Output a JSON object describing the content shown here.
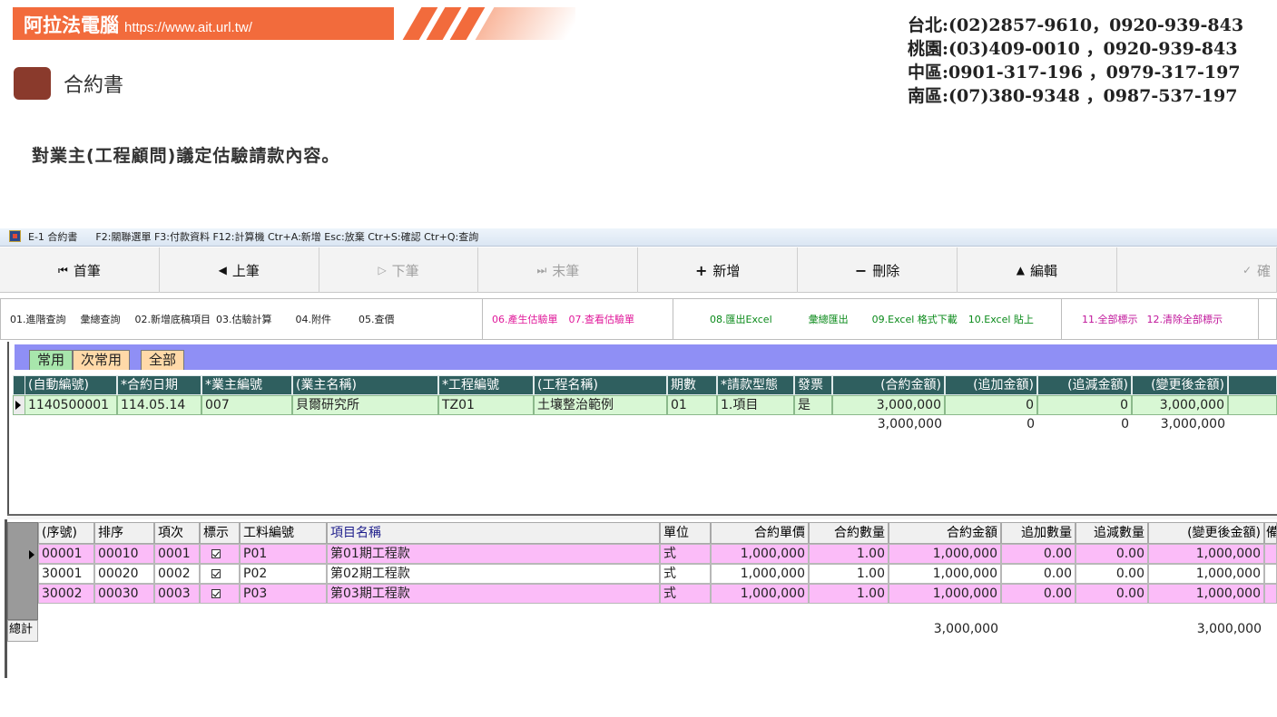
{
  "header": {
    "brand": "阿拉法電腦",
    "url": "https://www.ait.url.tw/",
    "page_title": "合約書",
    "contacts": [
      "台北:(02)2857-9610，0920-939-843",
      "桃園:(03)409-0010 ，0920-939-843",
      "中區:0901-317-196 ，0979-317-197",
      "南區:(07)380-9348 ，0987-537-197"
    ],
    "description": "對業主(工程顧問)議定估驗請款內容。"
  },
  "window": {
    "title": "E-1 合約書",
    "hotkeys": "F2:關聯選單 F3:付款資料 F12:計算機 Ctr+A:新增 Esc:放棄 Ctr+S:確認 Ctr+Q:查詢"
  },
  "nav": {
    "first": "首筆",
    "prev": "上筆",
    "next": "下筆",
    "last": "末筆",
    "add": "新增",
    "delete": "刪除",
    "edit": "編輯",
    "confirm": "確"
  },
  "toolbar": {
    "g1": [
      "01.進階查詢",
      "彙總查詢",
      "02.新增底稿項目",
      "03.估驗計算",
      "04.附件",
      "05.查價"
    ],
    "g2": [
      "06.產生估驗單",
      "07.查看估驗單"
    ],
    "g3": [
      "08.匯出Excel",
      "彙總匯出",
      "09.Excel 格式下載",
      "10.Excel 貼上"
    ],
    "g4": [
      "11.全部標示",
      "12.清除全部標示"
    ]
  },
  "tabs": [
    "常用",
    "次常用",
    "全部"
  ],
  "upper": {
    "headers": [
      "(自動編號)",
      "*合約日期",
      "*業主編號",
      "(業主名稱)",
      "*工程編號",
      "(工程名稱)",
      "期數",
      "*請款型態",
      "發票",
      "(合約金額)",
      "(追加金額)",
      "(追減金額)",
      "(變更後金額)"
    ],
    "row": [
      "1140500001",
      "114.05.14",
      "007",
      "貝爾研究所",
      "TZ01",
      "土壤整治範例",
      "01",
      "1.項目",
      "是",
      "3,000,000",
      "0",
      "0",
      "3,000,000"
    ],
    "totals": [
      "3,000,000",
      "0",
      "0",
      "3,000,000"
    ]
  },
  "lower": {
    "headers": [
      "(序號)",
      "排序",
      "項次",
      "標示",
      "工料編號",
      "項目名稱",
      "單位",
      "合約單價",
      "合約數量",
      "合約金額",
      "追加數量",
      "追減數量",
      "(變更後金額)",
      "備"
    ],
    "rows": [
      [
        "00001",
        "00010",
        "0001",
        "",
        "P01",
        "第01期工程款",
        "式",
        "1,000,000",
        "1.00",
        "1,000,000",
        "0.00",
        "0.00",
        "1,000,000"
      ],
      [
        "30001",
        "00020",
        "0002",
        "",
        "P02",
        "第02期工程款",
        "式",
        "1,000,000",
        "1.00",
        "1,000,000",
        "0.00",
        "0.00",
        "1,000,000"
      ],
      [
        "30002",
        "00030",
        "0003",
        "",
        "P03",
        "第03期工程款",
        "式",
        "1,000,000",
        "1.00",
        "1,000,000",
        "0.00",
        "0.00",
        "1,000,000"
      ]
    ],
    "total_label": "總計",
    "total_amount": "3,000,000",
    "total_changed": "3,000,000"
  }
}
